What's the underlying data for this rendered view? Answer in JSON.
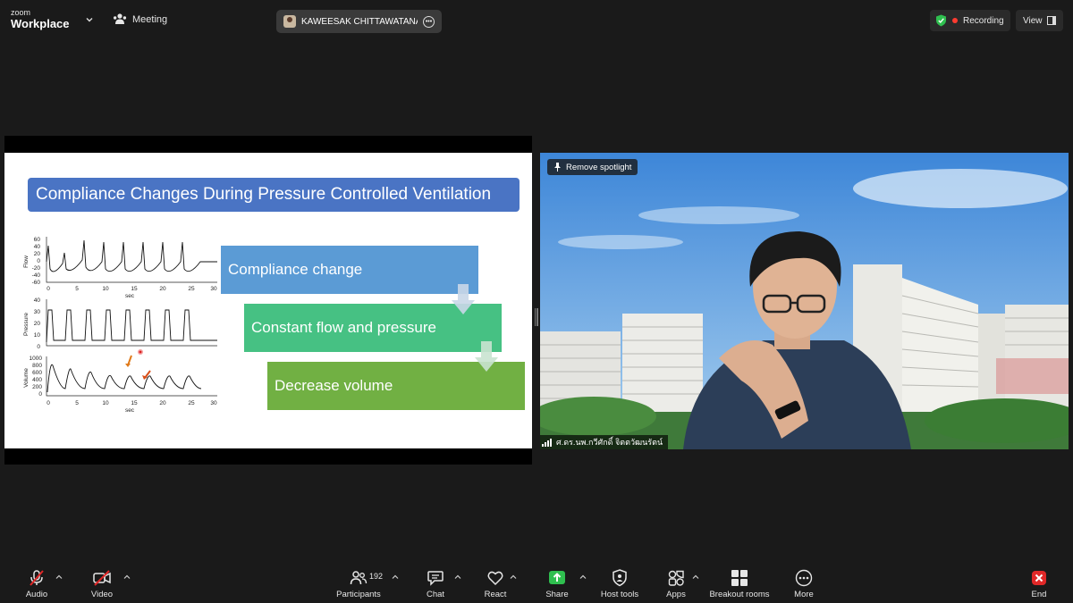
{
  "app": {
    "logo_top": "zoom",
    "logo_bottom": "Workplace"
  },
  "topbar": {
    "meeting_label": "Meeting",
    "host_name": "KAWEESAK CHITTAWATANARAT",
    "recording_label": "Recording",
    "view_label": "View",
    "colors": {
      "shield": "#2fbf4f",
      "recording_dot": "#ff3b30"
    }
  },
  "slide": {
    "title": "Compliance Changes During Pressure Controlled Ventilation",
    "boxes": [
      "Compliance  change",
      "Constant flow and pressure",
      "Decrease volume"
    ],
    "plots": {
      "x_label": "sec",
      "x_ticks": [
        "0",
        "5",
        "10",
        "15",
        "20",
        "25",
        "30"
      ],
      "flow": {
        "label": "Flow",
        "y_ticks": [
          "60",
          "40",
          "20",
          "0",
          "-20",
          "-40",
          "-60"
        ]
      },
      "pressure": {
        "label": "Pressure",
        "y_ticks": [
          "40",
          "30",
          "20",
          "10",
          "0"
        ]
      },
      "volume": {
        "label": "Volume",
        "y_ticks": [
          "1000",
          "800",
          "600",
          "400",
          "200",
          "0"
        ]
      }
    },
    "colors": {
      "title_bg": "#4a74c4",
      "box1": "#5b9bd5",
      "box2": "#46c183",
      "box3": "#71b043"
    }
  },
  "video": {
    "spotlight_label": "Remove spotlight",
    "participant_name": "ศ.ดร.นพ.กวีศักดิ์ จิตตวัฒนรัตน์"
  },
  "toolbar": {
    "audio": "Audio",
    "video": "Video",
    "participants": "Participants",
    "participants_count": "192",
    "chat": "Chat",
    "react": "React",
    "share": "Share",
    "host_tools": "Host tools",
    "apps": "Apps",
    "breakout": "Breakout rooms",
    "more": "More",
    "end": "End",
    "colors": {
      "share": "#2fbf4f",
      "end": "#e02828",
      "muted": "#e02828"
    }
  }
}
